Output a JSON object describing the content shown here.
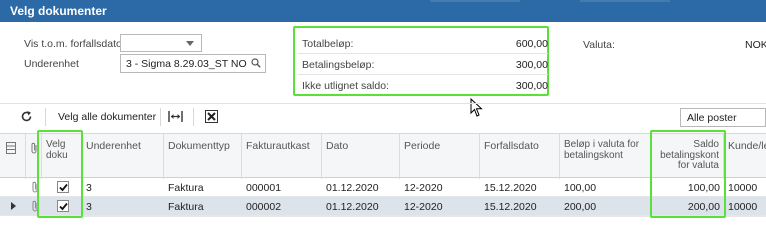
{
  "window": {
    "title": "Velg dokumenter"
  },
  "form": {
    "due_date_label": "Vis t.o.m. forfallsdato:",
    "due_date_value": "",
    "subaccount_label": "Underenhet",
    "subaccount_value": "3 - Sigma 8.29.03_ST NO",
    "currency_label": "Valuta:",
    "currency_value": "NOK"
  },
  "summary": {
    "total_label": "Totalbeløp:",
    "total_value": "600,00",
    "payment_label": "Betalingsbeløp:",
    "payment_value": "300,00",
    "unapplied_label": "Ikke utlignet saldo:",
    "unapplied_value": "300,00"
  },
  "toolbar": {
    "refresh_icon": "refresh-icon",
    "select_all_label": "Velg alle dokumenter",
    "fit_icon": "fit-columns-icon",
    "excel_icon": "export-excel-icon",
    "filter_value": "Alle poster"
  },
  "grid": {
    "columns": {
      "select": "Velg doku",
      "subaccount": "Underenhet",
      "doc_type": "Dokumenttyp",
      "invoice_ref": "Fakturautkast",
      "date": "Dato",
      "period": "Periode",
      "due_date": "Forfallsdato",
      "amount": "Beløp i valuta for betalingskont",
      "balance": "Saldo betalingskont for valuta",
      "customer": "Kunde/le"
    },
    "rows": [
      {
        "selected": true,
        "subaccount": "3",
        "doc_type": "Faktura",
        "invoice_ref": "000001",
        "date": "01.12.2020",
        "period": "12-2020",
        "due_date": "15.12.2020",
        "amount": "100,00",
        "balance": "100,00",
        "customer": "10000"
      },
      {
        "selected": true,
        "subaccount": "3",
        "doc_type": "Faktura",
        "invoice_ref": "000002",
        "date": "01.12.2020",
        "period": "12-2020",
        "due_date": "15.12.2020",
        "amount": "200,00",
        "balance": "200,00",
        "customer": "10000"
      }
    ]
  },
  "colors": {
    "title_bar": "#2b6aa6",
    "highlight": "#5be03a",
    "selected_row": "#dde3ea"
  }
}
